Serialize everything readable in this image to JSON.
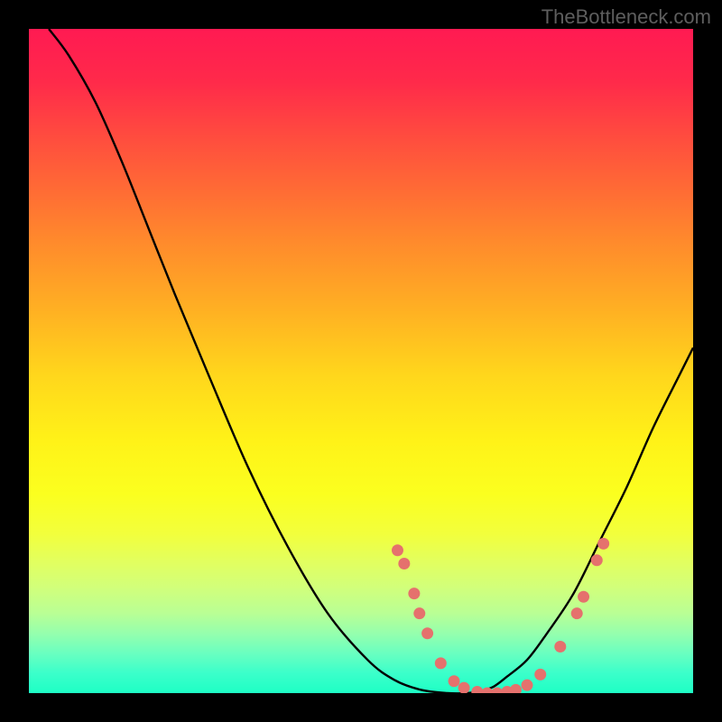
{
  "watermark": "TheBottleneck.com",
  "chart_data": {
    "type": "line",
    "title": "",
    "xlabel": "",
    "ylabel": "",
    "xlim": [
      0,
      100
    ],
    "ylim": [
      0,
      100
    ],
    "grid": false,
    "series": [
      {
        "name": "curve",
        "x": [
          3,
          6,
          10,
          14,
          18,
          22,
          27,
          33,
          39,
          45,
          51,
          55,
          59,
          63,
          66,
          68,
          70,
          72,
          75,
          78,
          82,
          86,
          90,
          94,
          98,
          100
        ],
        "values": [
          100,
          96,
          89,
          80,
          70,
          60,
          48,
          34,
          22,
          12,
          5,
          2,
          0.5,
          0,
          0,
          0.3,
          1,
          2.5,
          5,
          9,
          15,
          23,
          31,
          40,
          48,
          52
        ]
      }
    ],
    "points": [
      {
        "x": 55.5,
        "y": 21.5
      },
      {
        "x": 56.5,
        "y": 19.5
      },
      {
        "x": 58.0,
        "y": 15.0
      },
      {
        "x": 58.8,
        "y": 12.0
      },
      {
        "x": 60.0,
        "y": 9.0
      },
      {
        "x": 62.0,
        "y": 4.5
      },
      {
        "x": 64.0,
        "y": 1.8
      },
      {
        "x": 65.5,
        "y": 0.8
      },
      {
        "x": 67.5,
        "y": 0.2
      },
      {
        "x": 69.0,
        "y": 0.0
      },
      {
        "x": 70.5,
        "y": 0.0
      },
      {
        "x": 72.0,
        "y": 0.2
      },
      {
        "x": 73.3,
        "y": 0.5
      },
      {
        "x": 75.0,
        "y": 1.2
      },
      {
        "x": 77.0,
        "y": 2.8
      },
      {
        "x": 80.0,
        "y": 7.0
      },
      {
        "x": 82.5,
        "y": 12.0
      },
      {
        "x": 83.5,
        "y": 14.5
      },
      {
        "x": 85.5,
        "y": 20.0
      },
      {
        "x": 86.5,
        "y": 22.5
      }
    ]
  }
}
